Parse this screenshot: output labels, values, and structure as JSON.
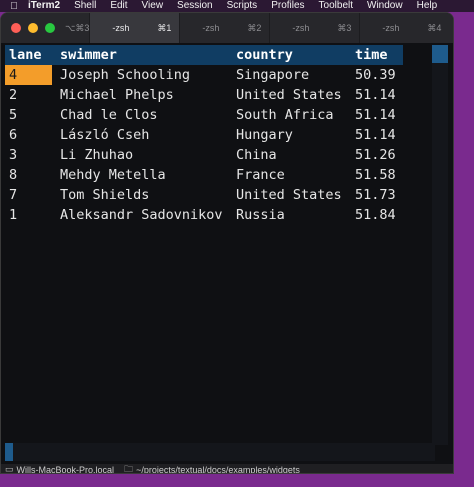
{
  "menubar": {
    "items": [
      "iTerm2",
      "Shell",
      "Edit",
      "View",
      "Session",
      "Scripts",
      "Profiles",
      "Toolbelt",
      "Window",
      "Help"
    ]
  },
  "titlebar": {
    "close_shortcut": "⌥⌘3",
    "tabs": [
      {
        "label": "-zsh",
        "shortcut": "⌘1",
        "active": true
      },
      {
        "label": "-zsh",
        "shortcut": "⌘2",
        "active": false
      },
      {
        "label": "-zsh",
        "shortcut": "⌘3",
        "active": false
      },
      {
        "label": "-zsh",
        "shortcut": "⌘4",
        "active": false
      }
    ],
    "plus": "+"
  },
  "table": {
    "columns": [
      "lane",
      "swimmer",
      "country",
      "time"
    ],
    "rows": [
      [
        "4",
        "Joseph Schooling",
        "Singapore",
        "50.39"
      ],
      [
        "2",
        "Michael Phelps",
        "United States",
        "51.14"
      ],
      [
        "5",
        "Chad le Clos",
        "South Africa",
        "51.14"
      ],
      [
        "6",
        "László Cseh",
        "Hungary",
        "51.14"
      ],
      [
        "3",
        "Li Zhuhao",
        "China",
        "51.26"
      ],
      [
        "8",
        "Mehdy Metella",
        "France",
        "51.58"
      ],
      [
        "7",
        "Tom Shields",
        "United States",
        "51.73"
      ],
      [
        "1",
        "Aleksandr Sadovnikov",
        "Russia",
        "51.84"
      ]
    ],
    "cursor": {
      "row": 0,
      "col": 0
    }
  },
  "statusbar": {
    "host": "Wills-MacBook-Pro.local",
    "path": "~/projects/textual/docs/examples/widgets"
  },
  "colors": {
    "header_bg": "#103d63",
    "cursor_bg": "#f39d2a",
    "scroll_thumb": "#1e5b8c"
  }
}
